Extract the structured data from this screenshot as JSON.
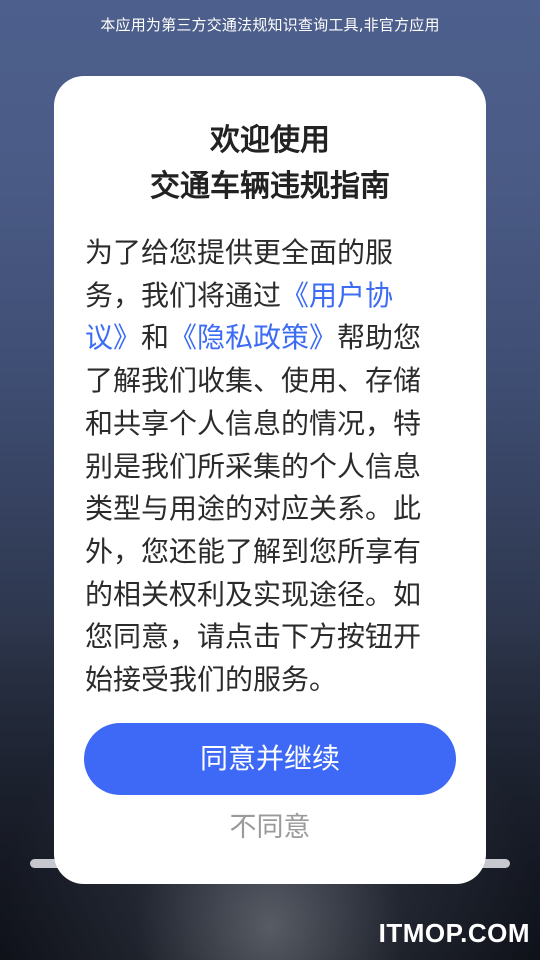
{
  "header": {
    "notice": "本应用为第三方交通法规知识查询工具,非官方应用"
  },
  "dialog": {
    "title_line1": "欢迎使用",
    "title_line2": "交通车辆违规指南",
    "body": {
      "part1": "为了给您提供更全面的服务，我们将通过",
      "link1": "《用户协议》",
      "part2": "和",
      "link2": "《隐私政策》",
      "part3": "帮助您了解我们收集、使用、存储和共享个人信息的情况，特别是我们所采集的个人信息类型与用途的对应关系。此外，您还能了解到您所享有的相关权利及实现途径。如您同意，请点击下方按钮开始接受我们的服务。"
    },
    "agree_label": "同意并继续",
    "disagree_label": "不同意"
  },
  "watermark": "ITMOP.COM",
  "colors": {
    "accent": "#3e69f6",
    "link": "#3d6cf4"
  }
}
